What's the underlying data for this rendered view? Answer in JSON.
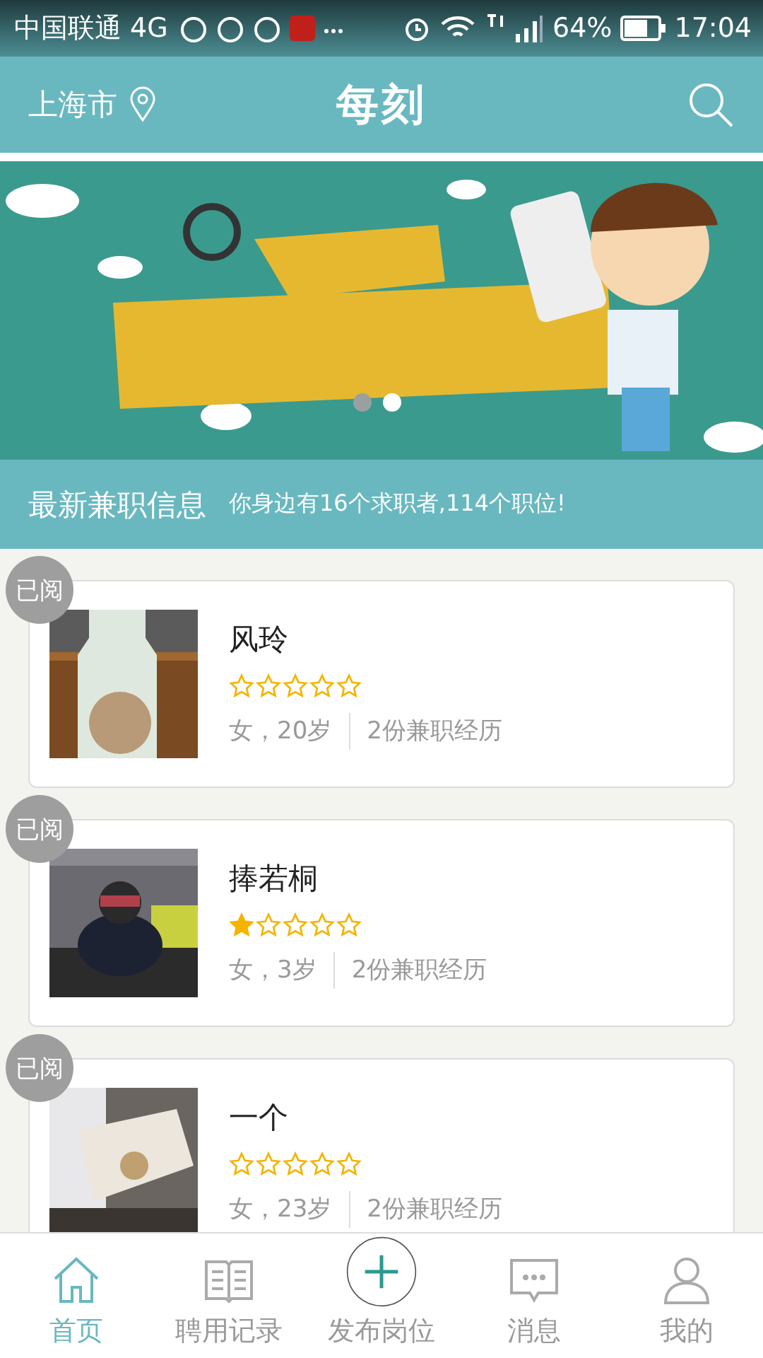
{
  "status_bar": {
    "carrier": "中国联通 4G",
    "battery": "64%",
    "time": "17:04"
  },
  "header": {
    "city": "上海市",
    "logo": "每刻"
  },
  "banner": {
    "dots": [
      {
        "selected": false
      },
      {
        "selected": true
      }
    ]
  },
  "info_bar": {
    "title": "最新兼职信息",
    "subtitle": "你身边有16个求职者,114个职位!"
  },
  "candidates": [
    {
      "badge": "已阅",
      "name": "风玲",
      "stars": 0,
      "gender_age": "女，20岁",
      "experience": "2份兼职经历"
    },
    {
      "badge": "已阅",
      "name": "捧若桐",
      "stars": 1,
      "gender_age": "女，3岁",
      "experience": "2份兼职经历"
    },
    {
      "badge": "已阅",
      "name": "一个",
      "stars": 0,
      "gender_age": "女，23岁",
      "experience": "2份兼职经历"
    }
  ],
  "nav": [
    {
      "label": "首页",
      "selected": true
    },
    {
      "label": "聘用记录",
      "selected": false
    },
    {
      "label": "发布岗位",
      "selected": false
    },
    {
      "label": "消息",
      "selected": false
    },
    {
      "label": "我的",
      "selected": false
    }
  ]
}
